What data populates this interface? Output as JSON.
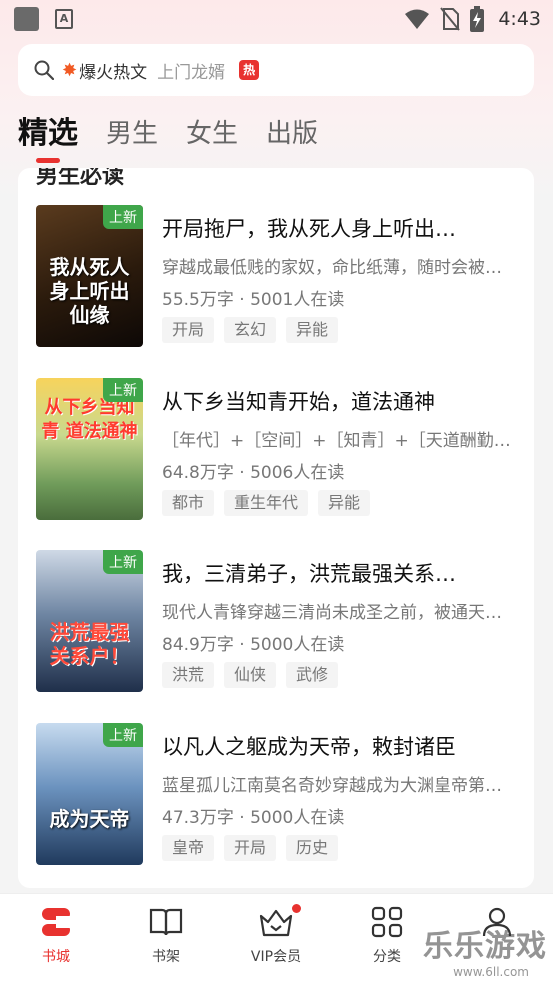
{
  "status_bar": {
    "time": "4:43"
  },
  "search": {
    "hot_label": "爆火热文",
    "hint": "上门龙婿",
    "hot_badge": "热"
  },
  "tabs": [
    {
      "label": "精选"
    },
    {
      "label": "男生"
    },
    {
      "label": "女生"
    },
    {
      "label": "出版"
    }
  ],
  "section": {
    "title": "男生必读"
  },
  "books": [
    {
      "title": "开局拖尸，我从死人身上听出…",
      "desc": "穿越成最低贱的家奴，命比纸薄，随时会被…",
      "stats": "55.5万字 · 5001人在读",
      "tags": [
        "开局",
        "玄幻",
        "异能"
      ],
      "badge": "上新",
      "cover_text": "我从死人身上听出仙缘"
    },
    {
      "title": "从下乡当知青开始，道法通神",
      "desc": "［年代］+［空间］+［知青］+［天道酬勤…",
      "stats": "64.8万字 · 5006人在读",
      "tags": [
        "都市",
        "重生年代",
        "异能"
      ],
      "badge": "上新",
      "cover_text": "从下乡当知青 道法通神"
    },
    {
      "title": "我，三清弟子，洪荒最强关系…",
      "desc": "现代人青锋穿越三清尚未成圣之前，被通天…",
      "stats": "84.9万字 · 5000人在读",
      "tags": [
        "洪荒",
        "仙侠",
        "武修"
      ],
      "badge": "上新",
      "cover_text": "洪荒最强关系户！"
    },
    {
      "title": "以凡人之躯成为天帝，敕封诸臣",
      "desc": "蓝星孤儿江南莫名奇妙穿越成为大渊皇帝第…",
      "stats": "47.3万字 · 5000人在读",
      "tags": [
        "皇帝",
        "开局",
        "历史"
      ],
      "badge": "上新",
      "cover_text": "成为天帝"
    }
  ],
  "bottom_nav": [
    {
      "label": "书城"
    },
    {
      "label": "书架"
    },
    {
      "label": "VIP会员"
    },
    {
      "label": "分类"
    },
    {
      "label": ""
    }
  ],
  "watermark": {
    "text": "乐乐游戏",
    "sub": "www.6ll.com"
  },
  "colors": {
    "accent": "#e8322f",
    "badge_green": "#3fa64a"
  }
}
